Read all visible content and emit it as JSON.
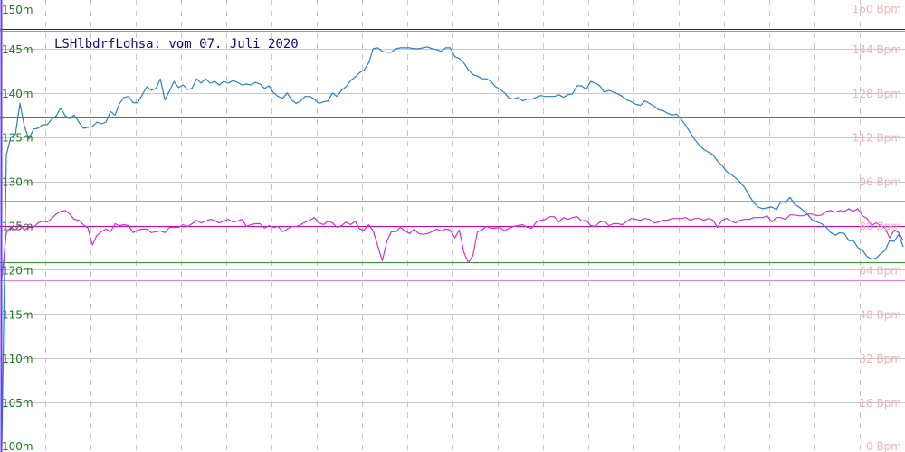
{
  "chart_data": {
    "type": "line",
    "title": "LSHlbdrfLohsa: vom 07. Juli 2020",
    "x_points": 200,
    "left_axis": {
      "ylim": [
        100,
        150
      ],
      "ticks": [
        100,
        105,
        110,
        115,
        120,
        125,
        130,
        135,
        140,
        145,
        150
      ],
      "tick_labels": [
        "100m",
        "105m",
        "110m",
        "115m",
        "120m",
        "125m",
        "130m",
        "135m",
        "140m",
        "145m",
        "150m"
      ]
    },
    "right_axis": {
      "ylim": [
        0,
        160
      ],
      "ticks": [
        0,
        16,
        32,
        48,
        64,
        80,
        96,
        112,
        128,
        144,
        160
      ],
      "tick_labels": [
        "0 Bpm",
        "16 Bpm",
        "32 Bpm",
        "48 Bpm",
        "64 Bpm",
        "80 Bpm",
        "96 Bpm",
        "112 Bpm",
        "128 Bpm",
        "144 Bpm",
        "160 Bpm"
      ]
    },
    "grid": true,
    "reference_lines": [
      {
        "axis": "left",
        "value": 147.2,
        "color": "#8b0000"
      },
      {
        "axis": "left",
        "value": 147.0,
        "color": "#c8a000"
      },
      {
        "axis": "left",
        "value": 137.3,
        "color": "#2e9a2e"
      },
      {
        "axis": "left",
        "value": 120.9,
        "color": "#2e9a2e"
      },
      {
        "axis": "left",
        "value": 127.8,
        "color": "#e67ee6"
      },
      {
        "axis": "left",
        "value": 125.0,
        "color": "#cc00cc"
      },
      {
        "axis": "left",
        "value": 118.8,
        "color": "#e67ee6"
      }
    ],
    "series": [
      {
        "axis": "left",
        "color": "#2a7fc8",
        "values": [
          100.0,
          133.0,
          135.0,
          135.3,
          138.8,
          136.2,
          134.8,
          135.9,
          136.0,
          136.4,
          136.4,
          137.0,
          137.4,
          138.3,
          137.4,
          137.1,
          137.5,
          136.7,
          136.0,
          136.1,
          136.2,
          136.7,
          136.5,
          136.7,
          137.9,
          137.5,
          138.8,
          139.5,
          139.6,
          138.9,
          138.9,
          139.8,
          140.7,
          140.3,
          140.5,
          141.6,
          139.2,
          140.2,
          141.3,
          140.6,
          140.9,
          140.4,
          140.5,
          141.6,
          141.1,
          141.6,
          141.1,
          141.3,
          140.9,
          141.3,
          141.1,
          141.4,
          141.2,
          140.9,
          141.0,
          140.9,
          141.2,
          141.0,
          140.5,
          140.8,
          140.0,
          139.6,
          139.4,
          140.0,
          139.2,
          138.8,
          139.1,
          139.6,
          139.6,
          139.3,
          138.8,
          139.0,
          139.1,
          140.0,
          139.6,
          140.3,
          140.7,
          141.4,
          141.8,
          142.3,
          142.6,
          143.4,
          145.0,
          145.1,
          144.7,
          144.6,
          144.6,
          145.0,
          145.1,
          145.1,
          145.1,
          145.0,
          145.0,
          145.1,
          145.2,
          145.0,
          144.9,
          144.7,
          145.1,
          145.1,
          144.1,
          143.9,
          143.4,
          142.6,
          142.1,
          141.9,
          141.6,
          141.6,
          141.3,
          140.7,
          140.4,
          140.0,
          139.4,
          139.3,
          139.5,
          139.1,
          139.3,
          139.3,
          139.5,
          139.7,
          139.6,
          139.6,
          139.6,
          139.8,
          139.5,
          139.8,
          139.9,
          140.8,
          140.8,
          140.4,
          141.3,
          141.1,
          140.8,
          140.1,
          140.3,
          140.1,
          139.9,
          139.6,
          139.2,
          139.0,
          138.7,
          138.6,
          139.1,
          138.8,
          138.5,
          138.1,
          138.0,
          137.7,
          137.5,
          137.6,
          137.0,
          136.3,
          135.5,
          134.7,
          134.1,
          133.6,
          133.3,
          133.0,
          132.3,
          131.8,
          131.1,
          130.8,
          130.4,
          129.9,
          129.3,
          128.4,
          127.6,
          127.1,
          126.9,
          127.0,
          127.1,
          126.8,
          127.7,
          127.6,
          128.2,
          127.4,
          127.1,
          126.7,
          126.2,
          125.6,
          125.4,
          125.2,
          124.8,
          124.2,
          123.9,
          124.2,
          124.1,
          123.3,
          123.3,
          122.5,
          122.2,
          121.5,
          121.2,
          121.3,
          121.8,
          122.2,
          123.3,
          123.2,
          124.0,
          122.6
        ]
      },
      {
        "axis": "left",
        "color": "#cc33cc",
        "values": [
          119.0,
          124.2,
          124.8,
          124.5,
          125.1,
          124.5,
          124.8,
          124.8,
          125.3,
          125.5,
          125.4,
          125.8,
          126.3,
          126.6,
          126.7,
          126.3,
          125.7,
          125.6,
          125.1,
          124.7,
          122.8,
          123.9,
          124.3,
          124.6,
          124.3,
          125.2,
          125.0,
          125.1,
          125.0,
          124.2,
          124.5,
          124.6,
          124.6,
          124.2,
          124.3,
          124.4,
          124.2,
          124.8,
          124.8,
          124.8,
          125.1,
          124.9,
          125.2,
          125.6,
          125.3,
          125.5,
          125.7,
          125.6,
          125.3,
          125.5,
          125.7,
          125.4,
          125.5,
          125.7,
          124.9,
          125.1,
          125.2,
          125.2,
          124.7,
          125.0,
          124.8,
          124.9,
          124.3,
          124.6,
          124.9,
          124.9,
          125.1,
          125.4,
          125.6,
          125.9,
          125.3,
          125.1,
          125.5,
          125.3,
          124.8,
          125.0,
          125.4,
          125.1,
          125.5,
          124.6,
          124.5,
          125.1,
          124.4,
          122.7,
          121.0,
          123.2,
          124.3,
          124.3,
          124.8,
          124.4,
          124.1,
          124.6,
          124.1,
          124.0,
          124.1,
          124.3,
          124.6,
          124.4,
          124.6,
          124.5,
          123.6,
          124.5,
          122.0,
          120.8,
          121.6,
          124.3,
          124.5,
          124.9,
          124.7,
          124.7,
          124.8,
          124.4,
          124.7,
          124.9,
          125.0,
          125.1,
          124.8,
          124.7,
          125.4,
          125.6,
          125.7,
          126.0,
          126.0,
          125.4,
          125.9,
          125.7,
          125.9,
          126.0,
          125.5,
          125.6,
          125.0,
          124.9,
          125.4,
          125.5,
          125.0,
          125.2,
          125.2,
          125.1,
          125.5,
          125.8,
          125.7,
          125.6,
          125.8,
          125.7,
          125.3,
          125.4,
          125.6,
          125.6,
          125.8,
          125.8,
          125.8,
          125.9,
          125.6,
          125.8,
          125.8,
          125.6,
          125.8,
          125.6,
          124.8,
          125.6,
          125.8,
          125.5,
          125.3,
          125.6,
          125.7,
          125.7,
          125.9,
          125.9,
          125.9,
          126.1,
          125.4,
          125.9,
          125.9,
          125.7,
          126.2,
          126.2,
          126.1,
          126.1,
          126.3,
          126.3,
          126.1,
          126.2,
          126.6,
          126.7,
          126.5,
          126.7,
          126.6,
          126.9,
          126.6,
          126.9,
          126.1,
          125.8,
          125.0,
          125.3,
          125.0,
          124.7,
          123.6,
          124.5,
          124.2,
          123.3
        ]
      }
    ]
  }
}
